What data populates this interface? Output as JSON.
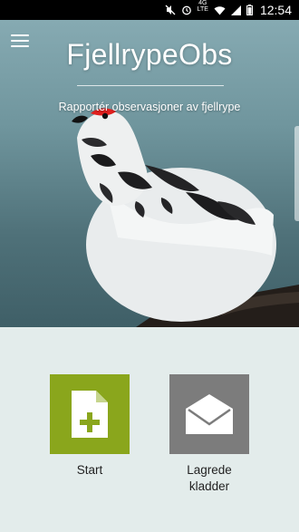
{
  "status_bar": {
    "network_top": "4G",
    "network_bottom": "LTE",
    "time": "12:54",
    "icons": [
      "mute-icon",
      "alarm-icon",
      "wifi-icon",
      "signal-icon",
      "battery-icon"
    ]
  },
  "header": {
    "menu_icon": "hamburger-menu-icon",
    "title": "FjellrypeObs",
    "subtitle": "Rapportér observasjoner av fjellrype"
  },
  "actions": [
    {
      "label": "Start",
      "icon": "add-document-icon",
      "color": "#8aa61c"
    },
    {
      "label": "Lagrede kladder",
      "icon": "envelope-open-icon",
      "color": "#7c7c7c"
    }
  ],
  "colors": {
    "background": "#e3eceb",
    "accent_green": "#8aa61c",
    "tile_gray": "#7c7c7c"
  }
}
